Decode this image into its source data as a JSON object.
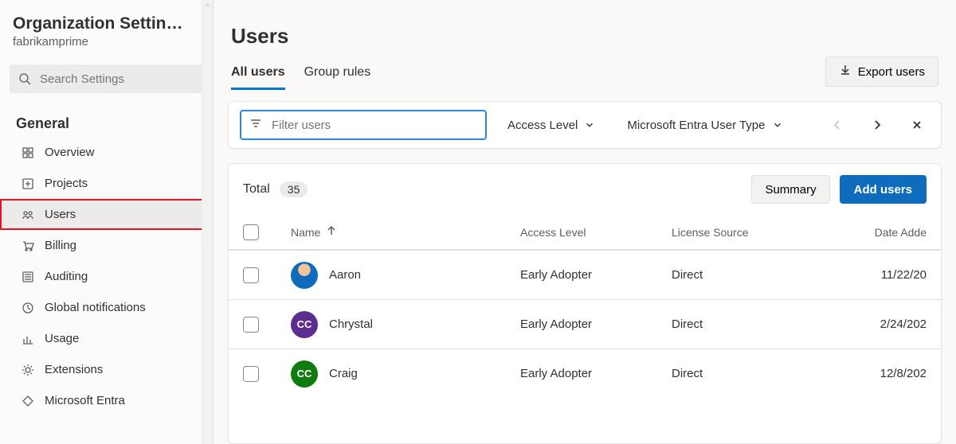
{
  "sidebar": {
    "title": "Organization Settin…",
    "subtitle": "fabrikamprime",
    "search_placeholder": "Search Settings",
    "section": "General",
    "items": [
      {
        "label": "Overview",
        "active": false,
        "icon": "grid"
      },
      {
        "label": "Projects",
        "active": false,
        "icon": "plus-box"
      },
      {
        "label": "Users",
        "active": true,
        "icon": "people"
      },
      {
        "label": "Billing",
        "active": false,
        "icon": "cart"
      },
      {
        "label": "Auditing",
        "active": false,
        "icon": "list"
      },
      {
        "label": "Global notifications",
        "active": false,
        "icon": "bell"
      },
      {
        "label": "Usage",
        "active": false,
        "icon": "chart"
      },
      {
        "label": "Extensions",
        "active": false,
        "icon": "gear"
      },
      {
        "label": "Microsoft Entra",
        "active": false,
        "icon": "diamond"
      }
    ]
  },
  "header": {
    "title": "Users",
    "tabs": [
      {
        "label": "All users",
        "active": true
      },
      {
        "label": "Group rules",
        "active": false
      }
    ],
    "export_label": "Export users"
  },
  "filterbar": {
    "placeholder": "Filter users",
    "chips": [
      {
        "label": "Access Level"
      },
      {
        "label": "Microsoft Entra User Type"
      }
    ]
  },
  "panel": {
    "total_label": "Total",
    "total_count": "35",
    "summary_label": "Summary",
    "add_label": "Add users",
    "columns": {
      "name": "Name",
      "access": "Access Level",
      "license": "License Source",
      "date": "Date Adde"
    },
    "rows": [
      {
        "name": "Aaron",
        "avatar": "img1",
        "initials": "",
        "access": "Early Adopter",
        "license": "Direct",
        "date": "11/22/20"
      },
      {
        "name": "Chrystal",
        "avatar": "cc1",
        "initials": "CC",
        "access": "Early Adopter",
        "license": "Direct",
        "date": "2/24/202"
      },
      {
        "name": "Craig",
        "avatar": "cc2",
        "initials": "CC",
        "access": "Early Adopter",
        "license": "Direct",
        "date": "12/8/202"
      }
    ]
  }
}
